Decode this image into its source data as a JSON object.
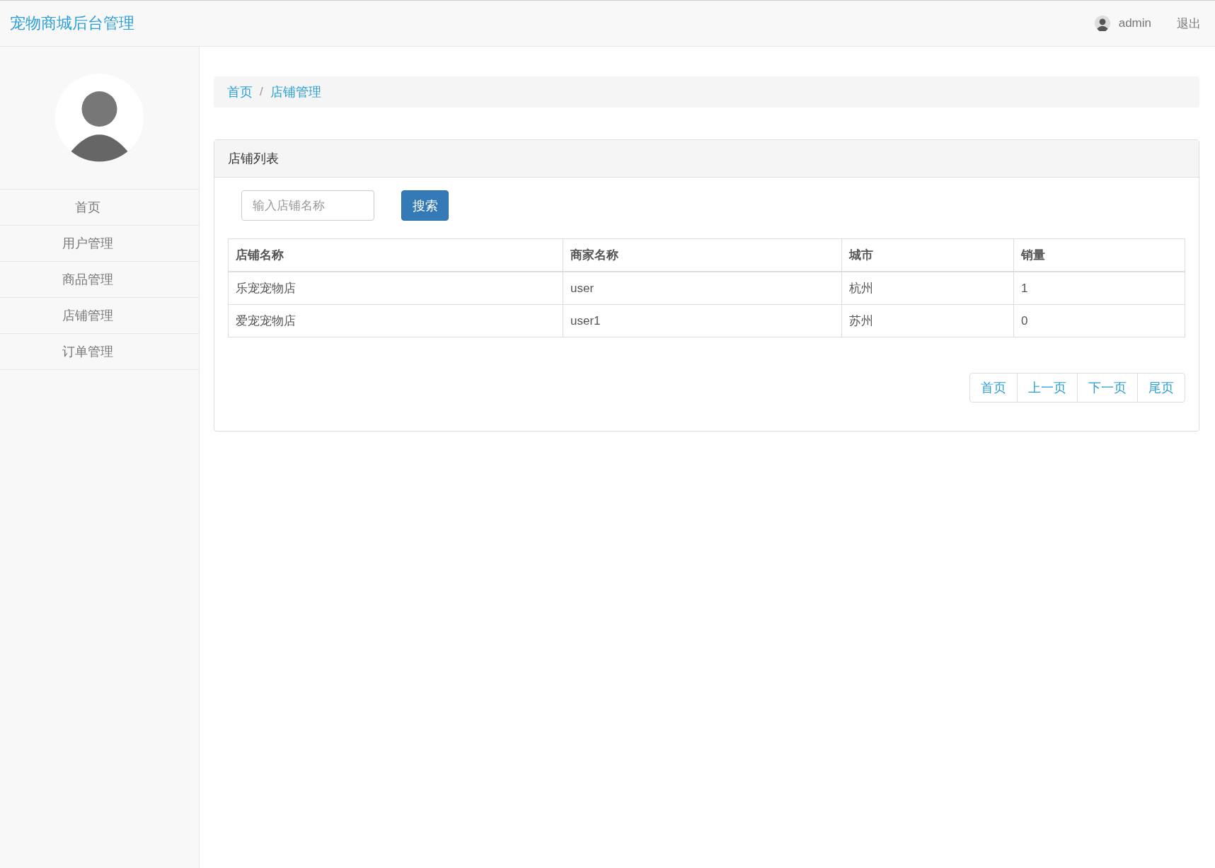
{
  "header": {
    "brand": "宠物商城后台管理",
    "user": "admin",
    "logout": "退出"
  },
  "sidebar": {
    "items": [
      {
        "label": "首页"
      },
      {
        "label": "用户管理"
      },
      {
        "label": "商品管理"
      },
      {
        "label": "店铺管理"
      },
      {
        "label": "订单管理"
      }
    ]
  },
  "breadcrumb": {
    "separator": "/",
    "items": [
      "首页",
      "店铺管理"
    ]
  },
  "panel": {
    "title": "店铺列表",
    "search": {
      "placeholder": "输入店铺名称",
      "button": "搜索"
    },
    "table": {
      "columns": [
        "店铺名称",
        "商家名称",
        "城市",
        "销量"
      ],
      "rows": [
        [
          "乐宠宠物店",
          "user",
          "杭州",
          "1"
        ],
        [
          "爱宠宠物店",
          "user1",
          "苏州",
          "0"
        ]
      ]
    },
    "pagination": [
      "首页",
      "上一页",
      "下一页",
      "尾页"
    ]
  }
}
